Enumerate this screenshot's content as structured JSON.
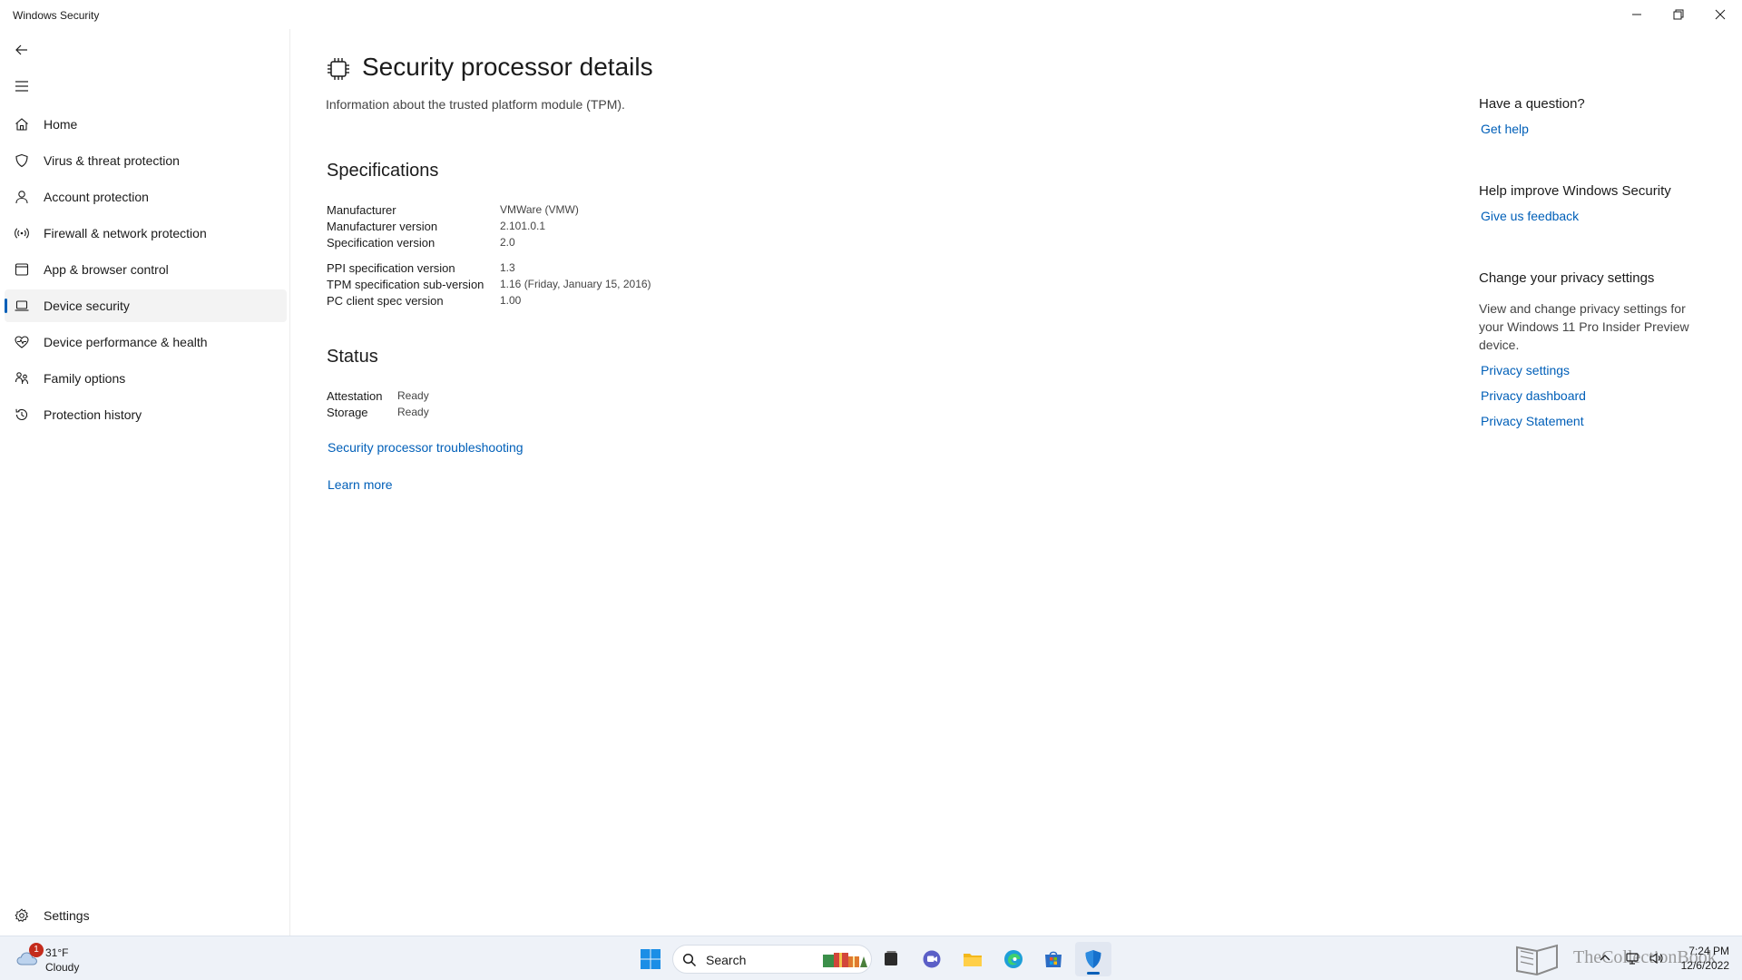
{
  "window": {
    "title": "Windows Security"
  },
  "sidebar": {
    "items": [
      {
        "label": "Home",
        "icon": "home-icon"
      },
      {
        "label": "Virus & threat protection",
        "icon": "shield-icon"
      },
      {
        "label": "Account protection",
        "icon": "person-icon"
      },
      {
        "label": "Firewall & network protection",
        "icon": "wireless-icon"
      },
      {
        "label": "App & browser control",
        "icon": "app-window-icon"
      },
      {
        "label": "Device security",
        "icon": "laptop-icon",
        "selected": true
      },
      {
        "label": "Device performance & health",
        "icon": "heart-pulse-icon"
      },
      {
        "label": "Family options",
        "icon": "family-icon"
      },
      {
        "label": "Protection history",
        "icon": "history-icon"
      }
    ],
    "settings_label": "Settings"
  },
  "main": {
    "title": "Security processor details",
    "subtitle": "Information about the trusted platform module (TPM).",
    "specifications": {
      "heading": "Specifications",
      "rows": [
        {
          "label": "Manufacturer",
          "value": "VMWare (VMW)"
        },
        {
          "label": "Manufacturer version",
          "value": "2.101.0.1"
        },
        {
          "label": "Specification version",
          "value": "2.0"
        },
        {
          "label": "PPI specification version",
          "value": "1.3"
        },
        {
          "label": "TPM specification sub-version",
          "value": "1.16 (Friday, January 15, 2016)"
        },
        {
          "label": "PC client spec version",
          "value": "1.00"
        }
      ]
    },
    "status": {
      "heading": "Status",
      "rows": [
        {
          "label": "Attestation",
          "value": "Ready"
        },
        {
          "label": "Storage",
          "value": "Ready"
        }
      ]
    },
    "troubleshooting_link": "Security processor troubleshooting",
    "learn_more_link": "Learn more"
  },
  "rail": {
    "question": {
      "heading": "Have a question?",
      "link": "Get help"
    },
    "improve": {
      "heading": "Help improve Windows Security",
      "link": "Give us feedback"
    },
    "privacy": {
      "heading": "Change your privacy settings",
      "text": "View and change privacy settings for your Windows 11 Pro Insider Preview device.",
      "links": [
        "Privacy settings",
        "Privacy dashboard",
        "Privacy Statement"
      ]
    }
  },
  "taskbar": {
    "weather": {
      "temp": "31°F",
      "condition": "Cloudy",
      "badge": "1"
    },
    "search_label": "Search",
    "time": "7:24 PM",
    "date": "12/6/2022",
    "watermark": "TheCollectionBook"
  },
  "colors": {
    "accent": "#005fb8",
    "selected_bg": "#f3f3f3"
  }
}
